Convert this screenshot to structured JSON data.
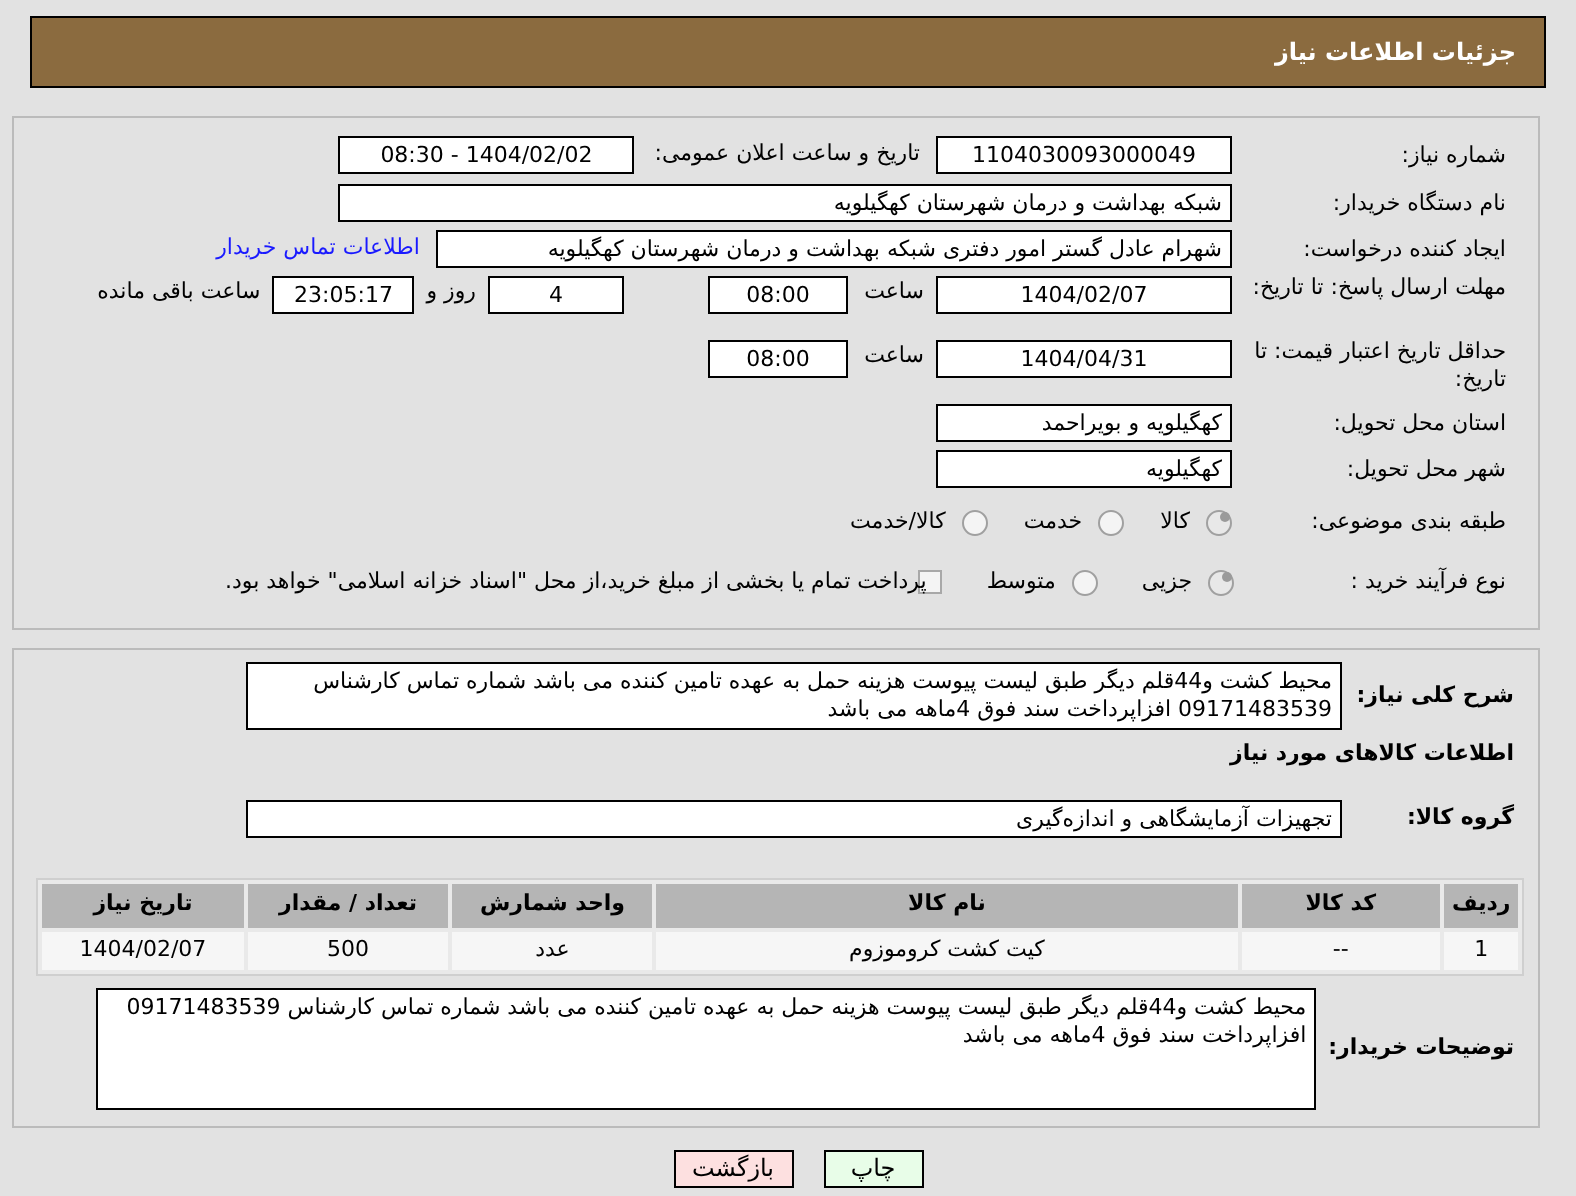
{
  "header": {
    "title": "جزئیات اطلاعات نیاز"
  },
  "fields": {
    "need_number": {
      "label": "شماره نیاز:",
      "value": "1104030093000049"
    },
    "announce": {
      "label": "تاریخ و ساعت اعلان عمومی:",
      "value": "1404/02/02 - 08:30"
    },
    "buyer": {
      "label": "نام دستگاه خریدار:",
      "value": "شبکه بهداشت و درمان شهرستان کهگیلویه"
    },
    "requester": {
      "label": "ایجاد کننده درخواست:",
      "value": "شهرام عادل گستر امور دفتری شبکه بهداشت و درمان شهرستان کهگیلویه",
      "link": "اطلاعات تماس خریدار"
    },
    "deadline": {
      "label": "مهلت ارسال پاسخ: تا تاریخ:",
      "date": "1404/02/07",
      "time_label": "ساعت",
      "time": "08:00",
      "days": "4",
      "days_label": "روز و",
      "remaining": "23:05:17",
      "remaining_label": "ساعت باقی مانده"
    },
    "validity": {
      "label": "حداقل تاریخ اعتبار قیمت: تا تاریخ:",
      "date": "1404/04/31",
      "time_label": "ساعت",
      "time": "08:00"
    },
    "province": {
      "label": "استان محل تحویل:",
      "value": "کهگیلویه و بویراحمد"
    },
    "city": {
      "label": "شهر محل تحویل:",
      "value": "کهگیلویه"
    }
  },
  "category": {
    "label": "طبقه بندی موضوعی:",
    "options": [
      {
        "label": "کالا",
        "selected": true
      },
      {
        "label": "خدمت",
        "selected": false
      },
      {
        "label": "کالا/خدمت",
        "selected": false
      }
    ]
  },
  "process": {
    "label": "نوع فرآیند خرید :",
    "options": [
      {
        "label": "جزیی",
        "selected": true
      },
      {
        "label": "متوسط",
        "selected": false
      }
    ],
    "payment": {
      "label": "پرداخت تمام یا بخشی از مبلغ خرید،از محل \"اسناد خزانه اسلامی\" خواهد بود.",
      "checked": false
    }
  },
  "description": {
    "label": "شرح کلی نیاز:",
    "value": "محیط کشت و44قلم دیگر  طبق لیست پیوست هزینه حمل به عهده تامین کننده می باشد شماره تماس کارشناس 09171483539 افزاپرداخت سند فوق 4ماهه می باشد"
  },
  "goods_heading": "اطلاعات کالاهای مورد نیاز",
  "group": {
    "label": "گروه کالا:",
    "value": "تجهیزات آزمایشگاهی و اندازه‌گیری"
  },
  "table": {
    "columns": [
      "ردیف",
      "کد کالا",
      "نام کالا",
      "واحد شمارش",
      "تعداد / مقدار",
      "تاریخ نیاز"
    ],
    "rows": [
      [
        "1",
        "--",
        "کیت کشت کروموزوم",
        "عدد",
        "500",
        "1404/02/07"
      ]
    ]
  },
  "buyer_notes": {
    "label": "توضیحات خریدار:",
    "value": "محیط کشت و44قلم دیگر  طبق لیست پیوست هزینه حمل به عهده تامین کننده می باشد شماره تماس کارشناس 09171483539 افزاپرداخت سند فوق 4ماهه می باشد"
  },
  "buttons": [
    {
      "label": "چاپ",
      "kind": "print"
    },
    {
      "label": "بازگشت",
      "kind": "back"
    }
  ]
}
